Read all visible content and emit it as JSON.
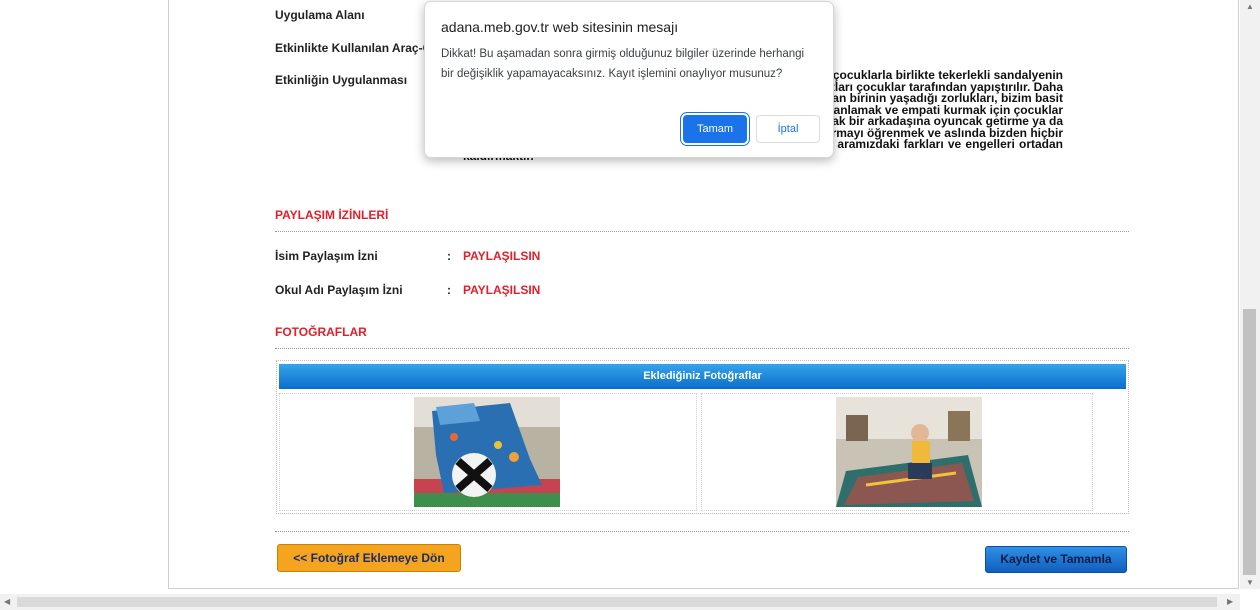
{
  "form": {
    "uygulama_alani_label": "Uygulama Alanı",
    "kullanilan_label": "Etkinlikte Kullanılan Araç-Ger",
    "uygulanmasi_label": "Etkinliğin Uygulanması",
    "body_lines": [
      "n çocuklarla birlikte tekerlekli sandalyenin",
      "natları çocuklar tarafından yapıştırılır. Daha",
      "ayan birinin yaşadığı zorlukları, bizim basit",
      "i anlamak ve empati kurmak için çocuklar",
      "rak bir arkadaşına oyuncak getirme ya da",
      "kurmayı öğrenmek ve aslında bizden hiçbir",
      "farklı olmayan ancak farklıymış gibi düşünülen engelli bireylerle aramızdaki farkları ve engelleri ortadan",
      "kaldırmaktır."
    ]
  },
  "permissions": {
    "title": "PAYLAŞIM İZİNLERİ",
    "isim_label": "İsim Paylaşım İzni",
    "isim_colon": ":",
    "isim_value": "PAYLAŞILSIN",
    "okul_label": "Okul Adı Paylaşım İzni",
    "okul_colon": ":",
    "okul_value": "PAYLAŞILSIN"
  },
  "photos": {
    "title": "FOTOĞRAFLAR",
    "header": "Eklediğiniz Fotoğraflar"
  },
  "buttons": {
    "back": "<< Fotoğraf Eklemeye Dön",
    "save": "Kaydet ve Tamamla"
  },
  "dialog": {
    "title": "adana.meb.gov.tr web sitesinin mesajı",
    "message": "Dikkat! Bu aşamadan sonra girmiş olduğunuz bilgiler üzerinde herhangi bir değişiklik yapamayacaksınız. Kayıt işlemini onaylıyor musunuz?",
    "ok": "Tamam",
    "cancel": "İptal"
  },
  "colors": {
    "accent_red": "#e0202a",
    "header_blue": "#1a7fd6",
    "back_orange": "#f4a41e",
    "dialog_blue": "#1a73e8"
  }
}
